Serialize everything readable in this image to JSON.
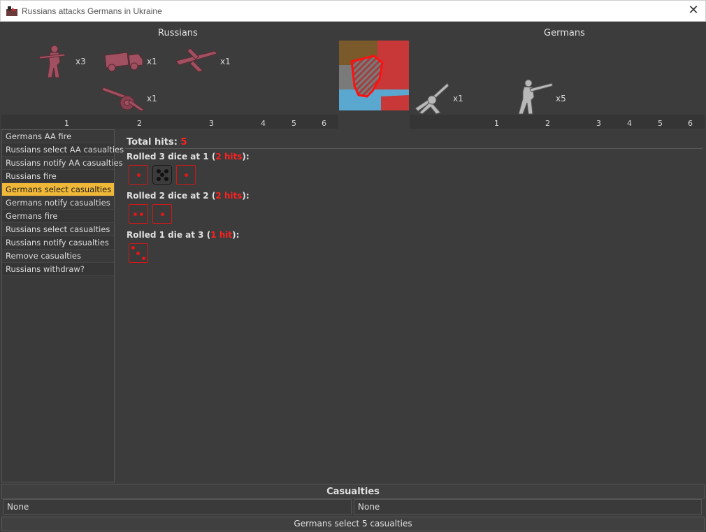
{
  "window": {
    "title": "Russians attacks Germans in Ukraine"
  },
  "attacker": {
    "name": "Russians",
    "units": [
      {
        "icon": "infantry-icon",
        "count": "x3"
      },
      {
        "icon": "truck-icon",
        "count": "x1"
      },
      {
        "icon": "fighter-icon",
        "count": "x1"
      },
      {
        "icon": "artillery-icon",
        "count": "x1"
      }
    ],
    "columns": [
      "1",
      "2",
      "3",
      "4",
      "5",
      "6"
    ],
    "color": "#9a4a56"
  },
  "defender": {
    "name": "Germans",
    "units": [
      {
        "icon": "aa-gun-icon",
        "count": "x1"
      },
      {
        "icon": "infantry-icon",
        "count": "x5"
      }
    ],
    "columns": [
      "1",
      "2",
      "3",
      "4",
      "5",
      "6"
    ],
    "color": "#9a9a9a"
  },
  "territory": {
    "icon": "territory-map-icon"
  },
  "steps": [
    "Germans AA fire",
    "Russians select AA casualties",
    "Russians notify AA casualties",
    "Russians fire",
    "Germans select casualties",
    "Germans notify casualties",
    "Germans fire",
    "Russians select casualties",
    "Russians notify casualties",
    "Remove casualties",
    "Russians withdraw?"
  ],
  "active_step": 4,
  "results": {
    "total_label": "Total hits: ",
    "total_value": "5",
    "rolls": [
      {
        "prefix": "Rolled 3 dice at 1 (",
        "hits": "2 hits",
        "suffix": "):",
        "dice": [
          1,
          5,
          1
        ],
        "hit": [
          true,
          false,
          true
        ]
      },
      {
        "prefix": "Rolled 2 dice at 2 (",
        "hits": "2 hits",
        "suffix": "):",
        "dice": [
          2,
          1
        ],
        "hit": [
          true,
          true
        ]
      },
      {
        "prefix": "Rolled 1 die at 3 (",
        "hits": "1 hit",
        "suffix": "):",
        "dice": [
          3
        ],
        "hit": [
          true
        ]
      }
    ]
  },
  "casualties": {
    "header": "Casualties",
    "left": "None",
    "right": "None"
  },
  "footer": {
    "button_label": "Germans select 5 casualties"
  },
  "colors": {
    "active_step": "#f0b838",
    "hit_red": "#ff2020",
    "background": "#3c3c3c"
  }
}
